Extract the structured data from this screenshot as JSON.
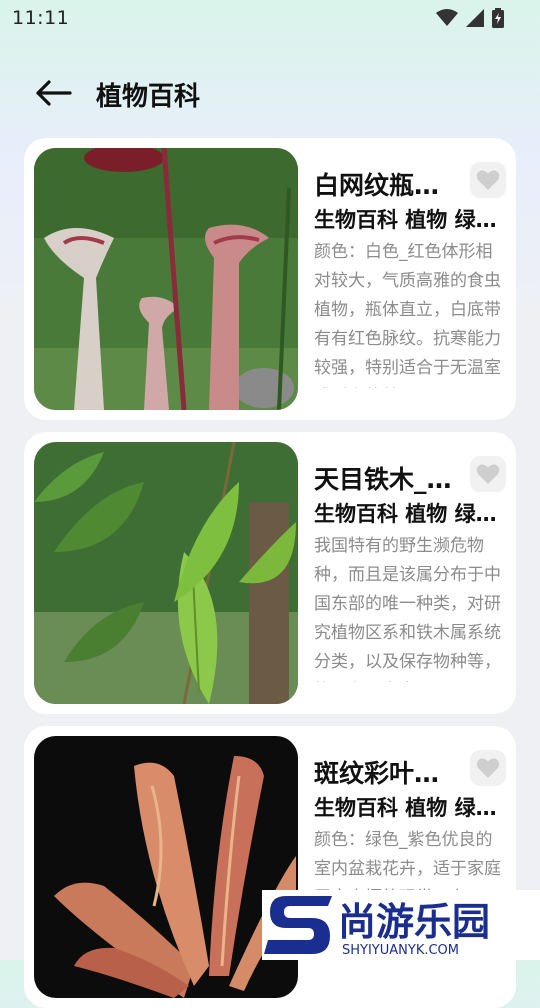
{
  "status_bar": {
    "time": "11:11"
  },
  "header": {
    "title": "植物百科"
  },
  "plants": [
    {
      "name": "白网纹瓶…",
      "tags": "生物百科 植物 绿…",
      "description": "颜色：白色_红色体形相对较大，气质高雅的食虫植物，瓶体直立，白底带有有红色脉纹。抗寒能力较强，特别适合于无温室或暖房的普通…"
    },
    {
      "name": "天目铁木_…",
      "tags": "生物百科 植物 绿…",
      "description": "我国特有的野生濒危物种，而且是该属分布于中国东部的唯一种类，对研究植物区系和铁木属系统分类，以及保存物种等，均具有一定意…"
    },
    {
      "name": "斑纹彩叶…",
      "tags": "生物百科 植物 绿…",
      "description": "颜色：绿色_紫色优良的室内盆栽花卉，适于家庭居室内摆放观赏，布…"
    }
  ],
  "watermark": {
    "brand": "尚游乐园",
    "url": "SHYIYUANYK.COM"
  },
  "colors": {
    "card_bg": "#ffffff",
    "title": "#111111",
    "desc": "#8c8c8c"
  }
}
